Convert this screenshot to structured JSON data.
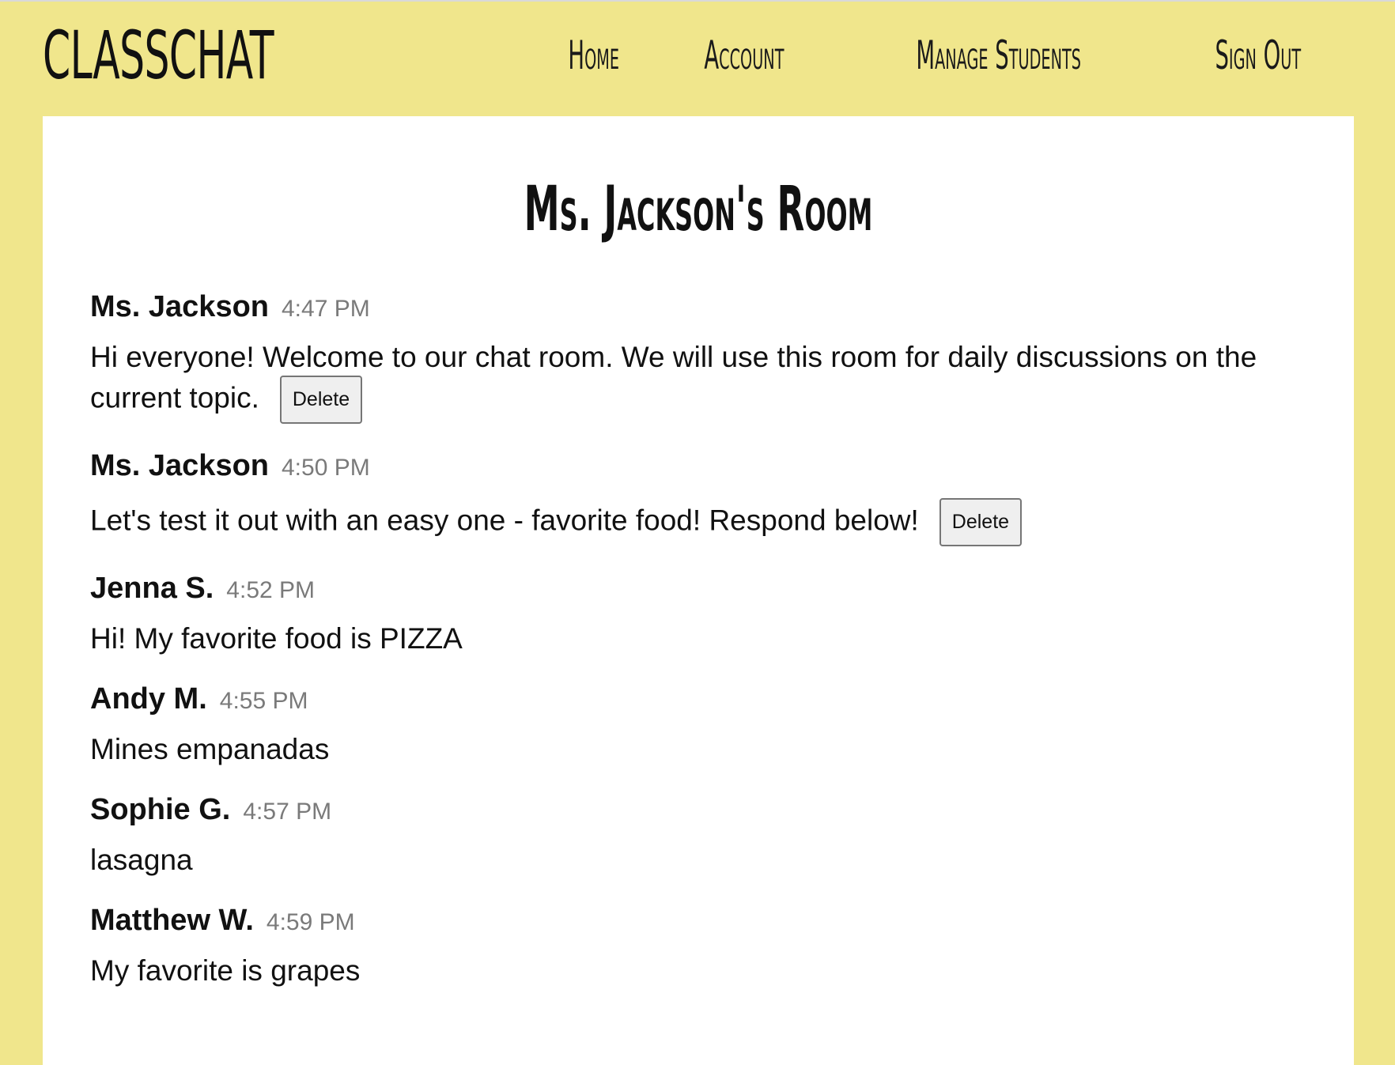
{
  "header": {
    "brand": "CLASSCHAT",
    "nav": [
      "Home",
      "Account",
      "Manage Students",
      "Sign Out"
    ]
  },
  "room": {
    "title": "Ms. Jackson's Room"
  },
  "messages": [
    {
      "author": "Ms. Jackson",
      "time": "4:47 PM",
      "text": "Hi everyone! Welcome to our chat room. We will use this room for daily discussions on the current topic.",
      "delete_label": "Delete"
    },
    {
      "author": "Ms. Jackson",
      "time": "4:50 PM",
      "text": "Let's test it out with an easy one - favorite food! Respond below!",
      "delete_label": "Delete"
    },
    {
      "author": "Jenna S.",
      "time": "4:52 PM",
      "text": "Hi! My favorite food is PIZZA"
    },
    {
      "author": "Andy M.",
      "time": "4:55 PM",
      "text": "Mines empanadas"
    },
    {
      "author": "Sophie G.",
      "time": "4:57 PM",
      "text": "lasagna"
    },
    {
      "author": "Matthew W.",
      "time": "4:59 PM",
      "text": "My favorite is grapes"
    }
  ],
  "colors": {
    "page_background": "#f0e68c",
    "panel_background": "#ffffff",
    "timestamp": "#7a7a7a"
  }
}
